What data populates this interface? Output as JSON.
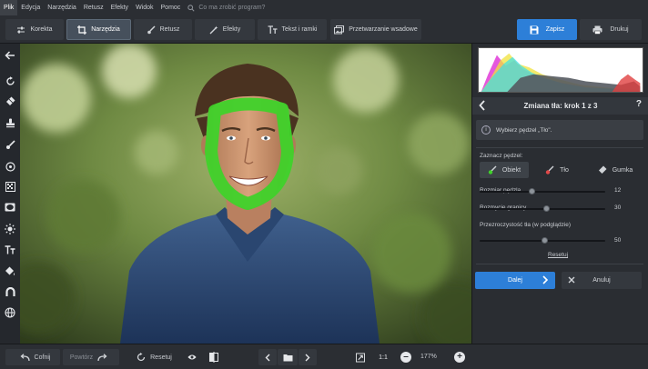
{
  "menu": {
    "items": [
      "Plik",
      "Edycja",
      "Narzędzia",
      "Retusz",
      "Efekty",
      "Widok",
      "Pomoc"
    ],
    "search_placeholder": "Co ma zrobić program?"
  },
  "tabs": [
    {
      "label": "Korekta",
      "icon": "sliders-icon"
    },
    {
      "label": "Narzędzia",
      "icon": "crop-icon",
      "active": true
    },
    {
      "label": "Retusz",
      "icon": "brush-icon"
    },
    {
      "label": "Efekty",
      "icon": "magic-wand-icon"
    },
    {
      "label": "Tekst i ramki",
      "icon": "text-icon"
    },
    {
      "label": "Przetwarzanie wsadowe",
      "icon": "images-icon"
    }
  ],
  "toolbar": {
    "save_label": "Zapisz",
    "print_label": "Drukuj"
  },
  "panel": {
    "step_title": "Zmiana tła: krok 1 z 3",
    "help": "?",
    "hint": "Wybierz pędzel „Tło\".",
    "select_brush_label": "Zaznacz pędzel:",
    "brushes": [
      "Obiekt",
      "Tło",
      "Gumka"
    ],
    "sliders": [
      {
        "label": "Rozmiar pędzla",
        "value": "12",
        "fraction": 0.42
      },
      {
        "label": "Rozmycie granicy",
        "value": "30",
        "fraction": 0.53
      },
      {
        "label": "Przezroczystość tła (w podglądzie)",
        "value": "50",
        "fraction": 0.52
      }
    ],
    "reset_label": "Resetuj",
    "next_label": "Dalej",
    "cancel_label": "Anuluj"
  },
  "bottom": {
    "undo_label": "Cofnij",
    "redo_label": "Powtórz",
    "reset_label": "Resetuj",
    "fit_label": "1:1",
    "zoom": "177%"
  },
  "colors": {
    "accent": "#2d7fd8",
    "selection": "#3fd22a",
    "background": "#1e2024"
  }
}
